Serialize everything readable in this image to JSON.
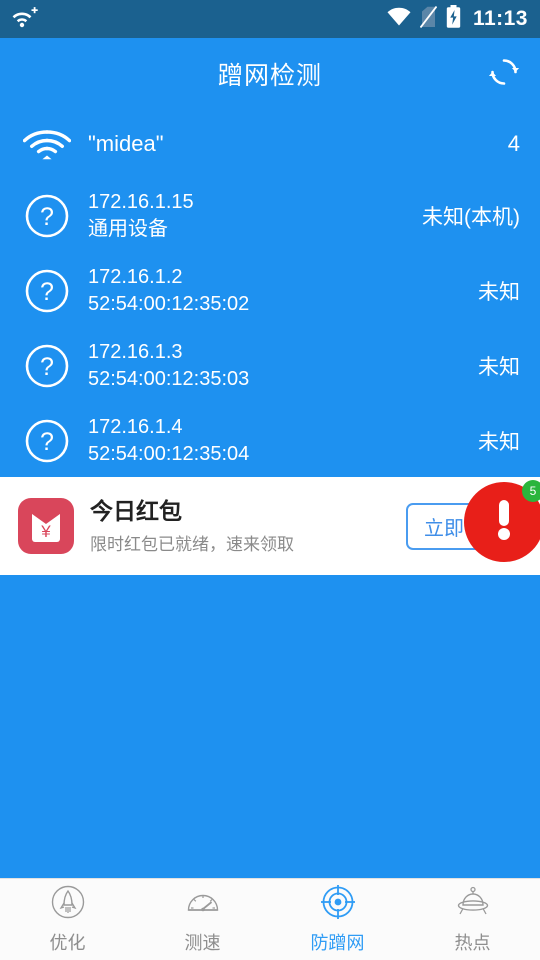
{
  "status_bar": {
    "left_icon": "wifi-plus-icon",
    "icons": [
      "wifi-icon",
      "sim-card-off-icon",
      "battery-charging-icon"
    ],
    "time": "11:13",
    "background": "#1b618f"
  },
  "app_bar": {
    "title": "蹭网检测",
    "refresh_icon": "refresh-icon",
    "background": "#1e91f0"
  },
  "wifi_header": {
    "icon": "wifi-icon",
    "ssid": "\"midea\"",
    "count": "4"
  },
  "devices": [
    {
      "icon": "unknown-device-icon",
      "ip": "172.16.1.15",
      "detail": "通用设备",
      "state": "未知(本机)"
    },
    {
      "icon": "unknown-device-icon",
      "ip": "172.16.1.2",
      "detail": "52:54:00:12:35:02",
      "state": "未知"
    },
    {
      "icon": "unknown-device-icon",
      "ip": "172.16.1.3",
      "detail": "52:54:00:12:35:03",
      "state": "未知"
    },
    {
      "icon": "unknown-device-icon",
      "ip": "172.16.1.4",
      "detail": "52:54:00:12:35:04",
      "state": "未知"
    }
  ],
  "ad_banner": {
    "icon": "red-envelope-icon",
    "title": "今日红包",
    "subtitle": "限时红包已就绪，速来领取",
    "cta_label": "立即领取",
    "alert": {
      "icon": "exclamation-icon",
      "badge": "5",
      "color": "#e81f19",
      "badge_color": "#2bb53c"
    }
  },
  "bottom_nav": {
    "items": [
      {
        "icon": "rocket-icon",
        "label": "优化",
        "active": false
      },
      {
        "icon": "speedometer-icon",
        "label": "测速",
        "active": false
      },
      {
        "icon": "target-icon",
        "label": "防蹭网",
        "active": true
      },
      {
        "icon": "hotspot-icon",
        "label": "热点",
        "active": false
      }
    ],
    "active_color": "#2f9cf5",
    "inactive_color": "#8e8e8e"
  }
}
